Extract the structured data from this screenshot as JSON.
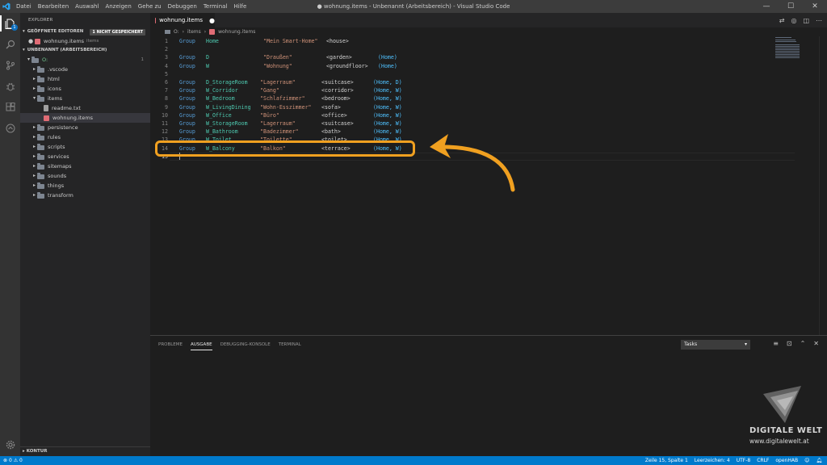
{
  "window": {
    "title": "● wohnung.items - Unbenannt (Arbeitsbereich) - Visual Studio Code",
    "menu": [
      "Datei",
      "Bearbeiten",
      "Auswahl",
      "Anzeigen",
      "Gehe zu",
      "Debuggen",
      "Terminal",
      "Hilfe"
    ],
    "controls": {
      "minimize": "—",
      "maximize": "☐",
      "close": "✕"
    }
  },
  "activity": {
    "explorer_badge": "1"
  },
  "sidebar": {
    "title": "EXPLORER",
    "open_editors": {
      "label": "GEÖFFNETE EDITOREN",
      "badge": "1 NICHT GESPEICHERT",
      "file": "wohnung.items",
      "file_desc": "items"
    },
    "workspace": {
      "label": "UNBENANNT (ARBEITSBEREICH)",
      "root": "O:",
      "root_count": "1"
    },
    "tree": [
      {
        "label": ".vscode",
        "type": "folder",
        "indent": 1,
        "open": false
      },
      {
        "label": "html",
        "type": "folder",
        "indent": 1,
        "open": false
      },
      {
        "label": "icons",
        "type": "folder",
        "indent": 1,
        "open": false
      },
      {
        "label": "items",
        "type": "folder",
        "indent": 1,
        "open": true
      },
      {
        "label": "readme.txt",
        "type": "file",
        "indent": 2
      },
      {
        "label": "wohnung.items",
        "type": "item",
        "indent": 2,
        "selected": true
      },
      {
        "label": "persistence",
        "type": "folder",
        "indent": 1,
        "open": false
      },
      {
        "label": "rules",
        "type": "folder",
        "indent": 1,
        "open": false
      },
      {
        "label": "scripts",
        "type": "folder",
        "indent": 1,
        "open": false
      },
      {
        "label": "services",
        "type": "folder",
        "indent": 1,
        "open": false
      },
      {
        "label": "sitemaps",
        "type": "folder",
        "indent": 1,
        "open": false
      },
      {
        "label": "sounds",
        "type": "folder",
        "indent": 1,
        "open": false
      },
      {
        "label": "things",
        "type": "folder",
        "indent": 1,
        "open": false
      },
      {
        "label": "transform",
        "type": "folder",
        "indent": 1,
        "open": false
      }
    ],
    "outline": "KONTUR"
  },
  "editor": {
    "tab": {
      "label": "wohnung.items",
      "dirty": "●"
    },
    "breadcrumb": [
      "O:",
      "items",
      "wohnung.items"
    ],
    "lines": [
      {
        "n": "1",
        "kw": "Group",
        "name": "Home",
        "label": "\"Mein Smart-Home\"",
        "icon": "<house>",
        "groups": ""
      },
      {
        "n": "2"
      },
      {
        "n": "3",
        "kw": "Group",
        "name": "D",
        "label": "\"Draußen\"",
        "icon": "<garden>",
        "groups": "(Home)"
      },
      {
        "n": "4",
        "kw": "Group",
        "name": "W",
        "label": "\"Wohnung\"",
        "icon": "<groundfloor>",
        "groups": "(Home)"
      },
      {
        "n": "5"
      },
      {
        "n": "6",
        "kw": "Group",
        "name": "D_StorageRoom",
        "label": "\"Lagerraum\"",
        "icon": "<suitcase>",
        "groups": "(Home, D)"
      },
      {
        "n": "7",
        "kw": "Group",
        "name": "W_Corridor",
        "label": "\"Gang\"",
        "icon": "<corridor>",
        "groups": "(Home, W)"
      },
      {
        "n": "8",
        "kw": "Group",
        "name": "W_Bedroom",
        "label": "\"Schlafzimmer\"",
        "icon": "<bedroom>",
        "groups": "(Home, W)"
      },
      {
        "n": "9",
        "kw": "Group",
        "name": "W_LivingDining",
        "label": "\"Wohn-Esszimmer\"",
        "icon": "<sofa>",
        "groups": "(Home, W)"
      },
      {
        "n": "10",
        "kw": "Group",
        "name": "W_Office",
        "label": "\"Büro\"",
        "icon": "<office>",
        "groups": "(Home, W)"
      },
      {
        "n": "11",
        "kw": "Group",
        "name": "W_StorageRoom",
        "label": "\"Lagerraum\"",
        "icon": "<suitcase>",
        "groups": "(Home, W)"
      },
      {
        "n": "12",
        "kw": "Group",
        "name": "W_Bathroom",
        "label": "\"Badezimmer\"",
        "icon": "<bath>",
        "groups": "(Home, W)"
      },
      {
        "n": "13",
        "kw": "Group",
        "name": "W_Toilet",
        "label": "\"Toilette\"",
        "icon": "<toilet>",
        "groups": "(Home, W)"
      },
      {
        "n": "14",
        "kw": "Group",
        "name": "W_Balcony",
        "label": "\"Balkon\"",
        "icon": "<terrace>",
        "groups": "(Home, W)"
      },
      {
        "n": "15"
      }
    ]
  },
  "panel": {
    "tabs": [
      "PROBLEME",
      "AUSGABE",
      "DEBUGGING-KONSOLE",
      "TERMINAL"
    ],
    "active_tab": 1,
    "select_value": "Tasks"
  },
  "watermark": {
    "name": "DIGITALE WELT",
    "url": "www.digitalewelt.at"
  },
  "statusbar": {
    "errors": "0",
    "warnings": "0",
    "position": "Zeile 15, Spalte 1",
    "indent": "Leerzeichen: 4",
    "encoding": "UTF-8",
    "eol": "CRLF",
    "language": "openHAB"
  },
  "colors": {
    "accent": "#007acc",
    "highlight": "#f0a020",
    "keyword": "#569cd6",
    "name": "#4ec9b0",
    "string": "#ce9178"
  }
}
